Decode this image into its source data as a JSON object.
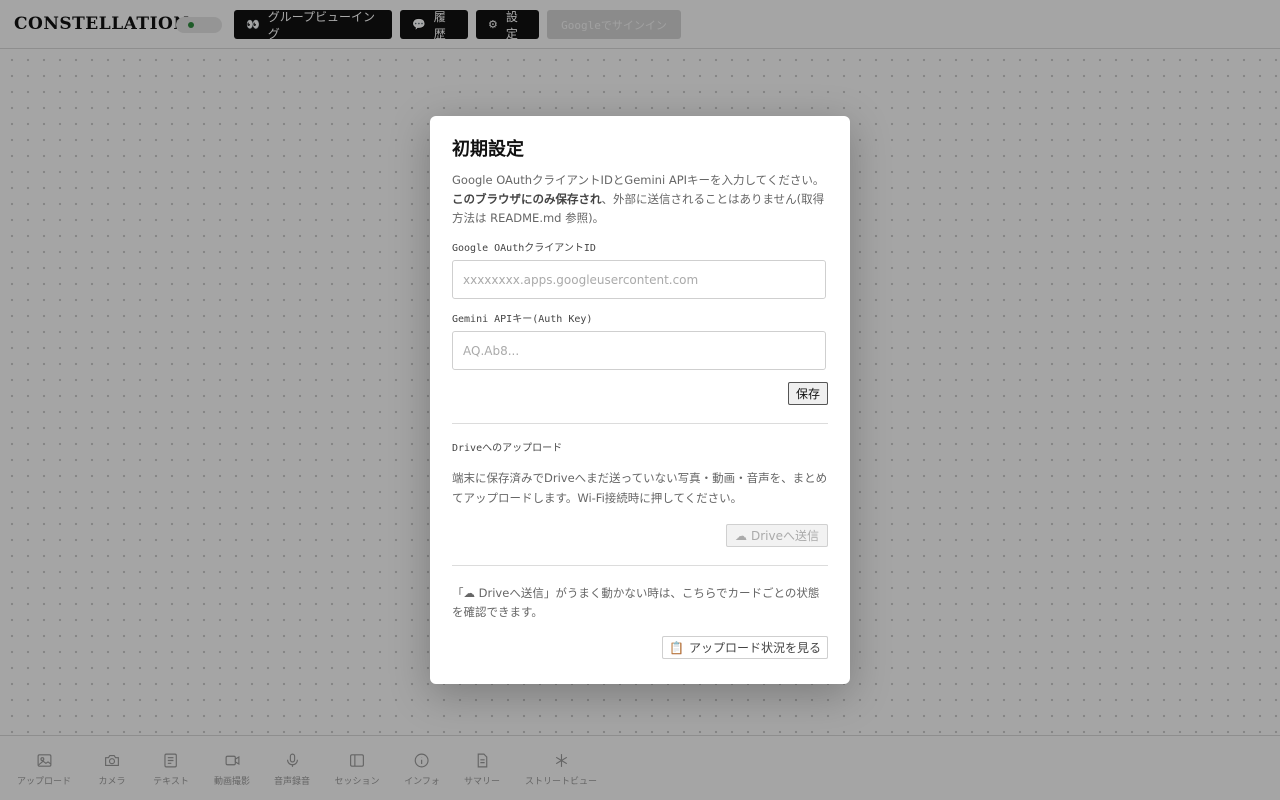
{
  "header": {
    "logo": "CONSTELLATION",
    "buttons": [
      {
        "icon": "eyes-icon",
        "glyph": "👀",
        "label": "グループビューイング"
      },
      {
        "icon": "speech-bubble-icon",
        "glyph": "💬",
        "label": "履歴"
      },
      {
        "icon": "gear-icon",
        "glyph": "⚙",
        "label": "設定"
      }
    ],
    "signin_label": "Googleでサインイン",
    "status_color": "#2e8b3e"
  },
  "modal": {
    "title": "初期設定",
    "desc_part1": "Google OAuthクライアントIDとGemini APIキーを入力してください。",
    "desc_bold": "このブラウザにのみ保存され",
    "desc_part2": "、外部に送信されることはありません(取得方法は README.md 参照)。",
    "client_id_label": "Google OAuthクライアントID",
    "client_id_placeholder": "xxxxxxxx.apps.googleusercontent.com",
    "api_key_label": "Gemini APIキー(Auth Key)",
    "api_key_placeholder": "AQ.Ab8...",
    "save_label": "保存",
    "drive_section_title": "Driveへのアップロード",
    "drive_section_desc": "端末に保存済みでDriveへまだ送っていない写真・動画・音声を、まとめてアップロードします。Wi-Fi接続時に押してください。",
    "drive_button_icon": "cloud-icon",
    "drive_button_label": "Driveへ送信",
    "note": "「☁ Driveへ送信」がうまく動かない時は、こちらでカードごとの状態を確認できます。",
    "status_button_icon": "clipboard-icon",
    "status_button_label": "アップロード状況を見る"
  },
  "bottom_nav": [
    {
      "icon": "image-icon",
      "label": "アップロード"
    },
    {
      "icon": "camera-icon",
      "label": "カメラ"
    },
    {
      "icon": "text-icon",
      "label": "テキスト"
    },
    {
      "icon": "video-icon",
      "label": "動画撮影"
    },
    {
      "icon": "microphone-icon",
      "label": "音声録音"
    },
    {
      "icon": "session-icon",
      "label": "セッション"
    },
    {
      "icon": "info-icon",
      "label": "インフォ"
    },
    {
      "icon": "document-icon",
      "label": "サマリー"
    },
    {
      "icon": "asterisk-icon",
      "label": "ストリートビュー"
    }
  ]
}
